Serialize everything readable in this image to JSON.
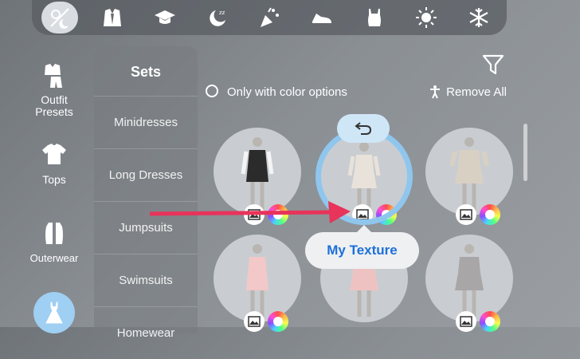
{
  "topbar": {
    "items": [
      {
        "icon": "day-night-icon",
        "active": true
      },
      {
        "icon": "suit-icon"
      },
      {
        "icon": "graduation-cap-icon"
      },
      {
        "icon": "moon-sleep-icon"
      },
      {
        "icon": "party-popper-icon"
      },
      {
        "icon": "sneaker-icon"
      },
      {
        "icon": "swimsuit-icon"
      },
      {
        "icon": "sun-icon"
      },
      {
        "icon": "snowflake-icon"
      }
    ]
  },
  "sidebar": {
    "items": [
      {
        "label": "Outfit Presets",
        "icon": "outfit-presets-icon"
      },
      {
        "label": "Tops",
        "icon": "tshirt-icon"
      },
      {
        "label": "Outerwear",
        "icon": "coat-icon"
      },
      {
        "label": "",
        "icon": "dress-icon",
        "active": true
      }
    ]
  },
  "sets": {
    "title": "Sets",
    "items": [
      "Minidresses",
      "Long Dresses",
      "Jumpsuits",
      "Swimsuits",
      "Homewear"
    ]
  },
  "filters": {
    "color_option_label": "Only with color options",
    "remove_all_label": "Remove All"
  },
  "tooltip": {
    "label": "My Texture"
  },
  "outfits": [
    {
      "name": "black-white-dress",
      "color": "#2b2b2b"
    },
    {
      "name": "white-lace-dress",
      "color": "#e8e2da",
      "selected": true
    },
    {
      "name": "ruffled-cream-dress",
      "color": "#d9d0c4"
    },
    {
      "name": "pink-dress",
      "color": "#f2c8c8"
    },
    {
      "name": "pink-ruffle-dress",
      "color": "#efc2c2"
    },
    {
      "name": "grey-floral-dress",
      "color": "#a8a6a6"
    }
  ],
  "colors": {
    "accent": "#1e6fd9",
    "ring": "#8fc6ee",
    "arrow": "#e8335a"
  }
}
